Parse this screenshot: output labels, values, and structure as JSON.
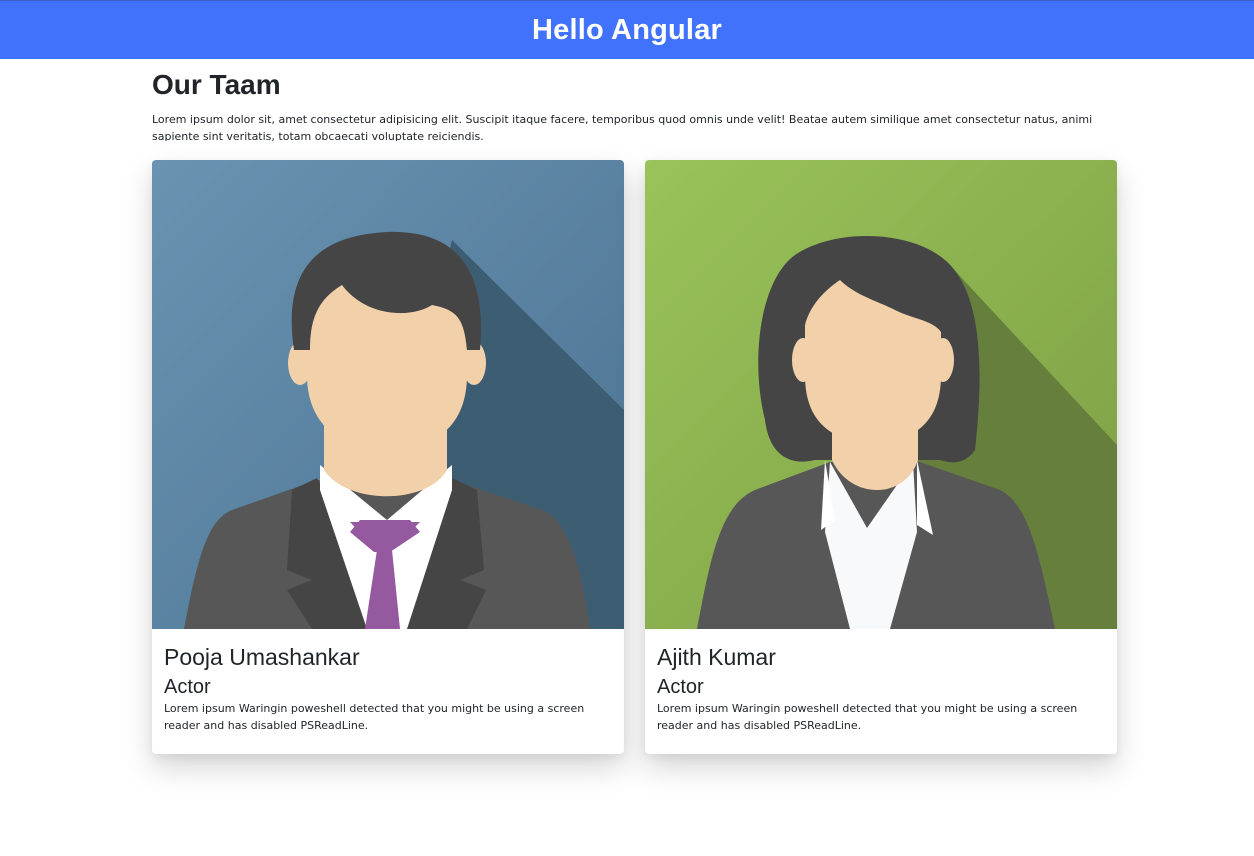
{
  "header": {
    "title": "Hello Angular",
    "color": "#4072fb"
  },
  "team": {
    "title": "Our Taam",
    "description": "Lorem ipsum dolor sit, amet consectetur adipisicing elit. Suscipit itaque facere, temporibus  quod omnis unde velit! Beatae autem similique amet consectetur natus, animi sapiente sint veritatis, totam obcaecati voluptate reiciendis."
  },
  "members": [
    {
      "name": "Pooja Umashankar",
      "role": "Actor",
      "text": "Lorem ipsum Waringin poweshell detected that you might be using a screen reader and has disabled PSReadLine.",
      "avatar_icon": "male-avatar-icon",
      "background_color": "#5b85a6"
    },
    {
      "name": "Ajith Kumar",
      "role": "Actor",
      "text": "Lorem ipsum Waringin poweshell detected that you might be using a screen reader and has disabled PSReadLine.",
      "avatar_icon": "female-avatar-icon",
      "background_color": "#8db250"
    }
  ]
}
